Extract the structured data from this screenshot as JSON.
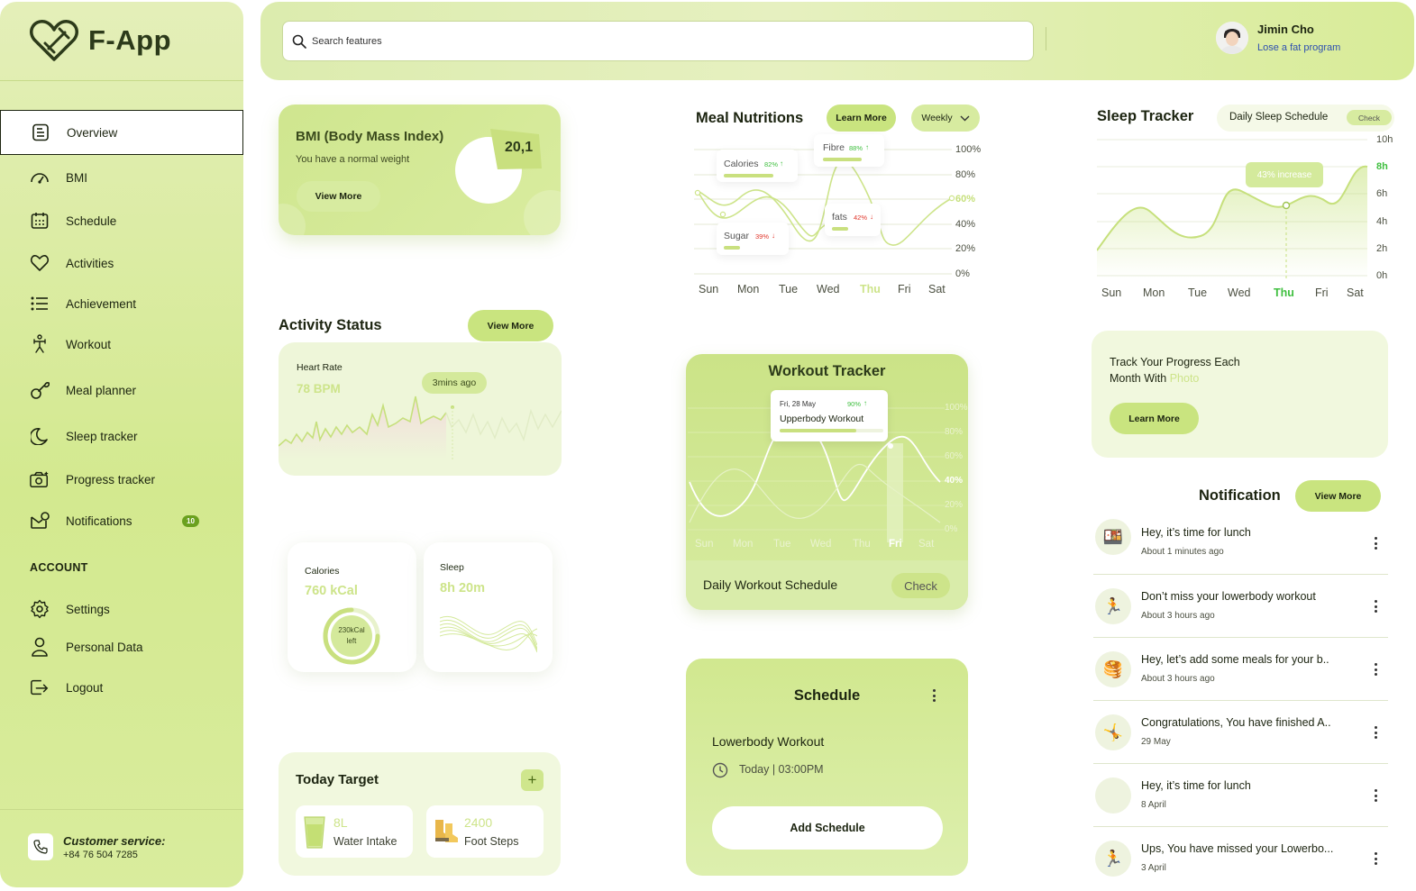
{
  "app": {
    "name": "F-App"
  },
  "sidebar": {
    "items": [
      {
        "label": "Overview",
        "icon": "overview-icon"
      },
      {
        "label": "BMI",
        "icon": "bmi-icon"
      },
      {
        "label": "Schedule",
        "icon": "calendar-icon"
      },
      {
        "label": "Activities",
        "icon": "heart-icon"
      },
      {
        "label": "Achievement",
        "icon": "list-icon"
      },
      {
        "label": "Workout",
        "icon": "workout-icon"
      },
      {
        "label": "Meal planner",
        "icon": "meal-icon"
      },
      {
        "label": "Sleep tracker",
        "icon": "moon-icon"
      },
      {
        "label": "Progress tracker",
        "icon": "camera-icon"
      },
      {
        "label": "Notifications",
        "icon": "notification-icon",
        "badge": "10"
      }
    ],
    "account_label": "ACCOUNT",
    "account_items": [
      {
        "label": "Settings",
        "icon": "gear-icon"
      },
      {
        "label": "Personal Data",
        "icon": "person-icon"
      },
      {
        "label": "Logout",
        "icon": "logout-icon"
      }
    ],
    "customer_service": {
      "title": "Customer service:",
      "phone": "+84 76 504 7285"
    }
  },
  "header": {
    "search_placeholder": "Search features",
    "user_name": "Jimin Cho",
    "user_program": "Lose a fat program"
  },
  "bmi": {
    "title": "BMI (Body Mass Index)",
    "subtitle": "You have a normal weight",
    "button": "View More",
    "value": "20,1"
  },
  "activity": {
    "title": "Activity Status",
    "button": "View More",
    "heart_label": "Heart Rate",
    "heart_value": "78 BPM",
    "tooltip": "3mins ago",
    "calories_label": "Calories",
    "calories_value": "760 kCal",
    "calories_left": "230kCal left",
    "sleep_label": "Sleep",
    "sleep_value": "8h 20m"
  },
  "today_target": {
    "title": "Today Target",
    "add": "+",
    "water_value": "8L",
    "water_label": "Water Intake",
    "steps_value": "2400",
    "steps_label": "Foot Steps"
  },
  "meal": {
    "title": "Meal Nutritions",
    "learn_more": "Learn More",
    "period": "Weekly",
    "labels": {
      "calories": "Calories",
      "calories_pct": "82%",
      "fibre": "Fibre",
      "fibre_pct": "88%",
      "sugar": "Sugar",
      "sugar_pct": "39%",
      "fats": "fats",
      "fats_pct": "42%"
    },
    "y_ticks": [
      "100%",
      "80%",
      "60%",
      "40%",
      "20%",
      "0%"
    ],
    "days": [
      "Sun",
      "Mon",
      "Tue",
      "Wed",
      "Thu",
      "Fri",
      "Sat"
    ],
    "highlight_day": "Thu"
  },
  "workout": {
    "title": "Workout Tracker",
    "tooltip_date": "Fri, 28 May",
    "tooltip_pct": "90%",
    "tooltip_title": "Upperbody Workout",
    "y_ticks": [
      "100%",
      "80%",
      "60%",
      "40%",
      "20%",
      "0%"
    ],
    "days": [
      "Sun",
      "Mon",
      "Tue",
      "Wed",
      "Thu",
      "Fri",
      "Sat"
    ],
    "highlight_day": "Fri",
    "daily_label": "Daily Workout Schedule",
    "check": "Check"
  },
  "schedule": {
    "title": "Schedule",
    "item_title": "Lowerbody Workout",
    "item_time": "Today | 03:00PM",
    "add_button": "Add Schedule"
  },
  "sleep": {
    "title": "Sleep Tracker",
    "schedule_label": "Daily Sleep Schedule",
    "check": "Check",
    "tooltip": "43% increase",
    "y_ticks": [
      "10h",
      "8h",
      "6h",
      "4h",
      "2h",
      "0h"
    ],
    "days": [
      "Sun",
      "Mon",
      "Tue",
      "Wed",
      "Thu",
      "Fri",
      "Sat"
    ],
    "highlight_day": "Thu"
  },
  "progress": {
    "line1": "Track Your Progress Each",
    "line2": "Month With",
    "highlight": "Photo",
    "button": "Learn More"
  },
  "notifications": {
    "title": "Notification",
    "button": "View More",
    "items": [
      {
        "title": "Hey, it’s time for lunch",
        "time": "About 1 minutes ago",
        "icon": "🍱"
      },
      {
        "title": "Don’t miss your lowerbody workout",
        "time": "About 3 hours ago",
        "icon": "🏃"
      },
      {
        "title": "Hey, let’s add some meals for your b..",
        "time": "About 3 hours ago",
        "icon": "🥞"
      },
      {
        "title": "Congratulations, You have finished A..",
        "time": "29 May",
        "icon": "🤸"
      },
      {
        "title": "Hey, it’s time for lunch",
        "time": "8 April",
        "icon": ""
      },
      {
        "title": "Ups, You have missed your Lowerbo...",
        "time": "3 April",
        "icon": "🏃"
      }
    ]
  },
  "colors": {
    "accent": "#c9e47f",
    "accent_dark": "#6aa11f",
    "sidebar_bg": "#d3e98f",
    "text_dark": "#1c2410",
    "increase": "#3fbf3f",
    "decrease": "#e0362b"
  }
}
